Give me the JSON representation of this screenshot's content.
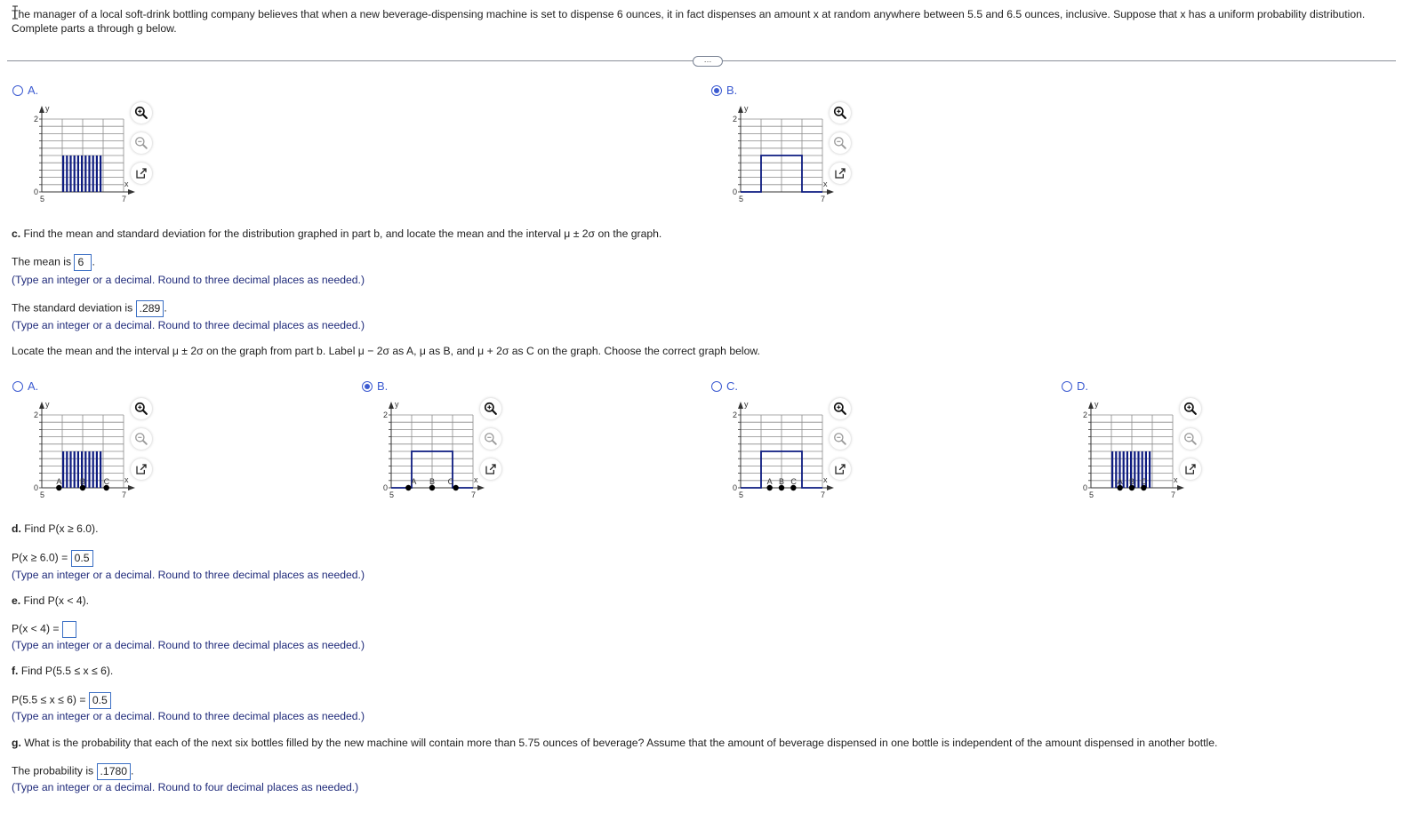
{
  "intro": {
    "text": "The manager of a local soft-drink bottling company believes that when a new beverage-dispensing machine is set to dispense 6 ounces, it in fact dispenses an amount x at random anywhere between 5.5 and 6.5 ounces, inclusive. Suppose that x has a uniform probability distribution. Complete parts a through g below."
  },
  "expand_button": "…",
  "part_b_options": [
    {
      "letter": "A.",
      "selected": false,
      "style": "shaded-rect",
      "show_points": false
    },
    {
      "letter": "B.",
      "selected": true,
      "style": "outline-rect",
      "show_points": false
    }
  ],
  "graph_common": {
    "y_label": "y",
    "x_label": "x",
    "y_top_tick": "2",
    "y_zero_tick": "0",
    "x_min_tick": "5",
    "x_max_tick": "7",
    "xlim": [
      5,
      7
    ],
    "ylim": [
      0,
      2
    ],
    "uniform_low": 5.5,
    "uniform_high": 6.5,
    "density": 1,
    "colors": {
      "curve": "#0d1b80",
      "grid": "#8c8c8c",
      "axis": "#333333"
    }
  },
  "part_c": {
    "prompt_bold": "c.",
    "prompt": " Find the mean and standard deviation for the distribution graphed in part b, and locate the mean and the interval μ ± 2σ on the graph.",
    "mean_label": "The mean is",
    "mean_value": "6",
    "sd_label": "The standard deviation is",
    "sd_value": ".289",
    "hint_three": "(Type an integer or a decimal. Round to three decimal places as needed.)",
    "locate_prompt": "Locate the mean and the interval μ ± 2σ on the graph from part b. Label μ − 2σ as A, μ as B, and μ + 2σ as C on the graph. Choose the correct graph below."
  },
  "part_c_options": [
    {
      "letter": "A.",
      "selected": false,
      "style": "shaded-rect",
      "points": [
        5.42,
        6.0,
        6.58
      ],
      "labels": [
        "A",
        "B",
        "C"
      ]
    },
    {
      "letter": "B.",
      "selected": true,
      "style": "outline-rect",
      "points": [
        5.42,
        6.0,
        6.58
      ],
      "labels": [
        "A",
        "B",
        "C"
      ]
    },
    {
      "letter": "C.",
      "selected": false,
      "style": "outline-rect",
      "points": [
        5.71,
        6.0,
        6.29
      ],
      "labels": [
        "A",
        "B",
        "C"
      ]
    },
    {
      "letter": "D.",
      "selected": false,
      "style": "shaded-rect",
      "points": [
        5.71,
        6.0,
        6.29
      ],
      "labels": [
        "A",
        "B",
        "C"
      ]
    }
  ],
  "part_d": {
    "prompt_bold": "d.",
    "prompt": " Find P(x ≥ 6.0).",
    "answer_label": "P(x ≥ 6.0) =",
    "answer": "0.5",
    "hint": "(Type an integer or a decimal. Round to three decimal places as needed.)"
  },
  "part_e": {
    "prompt_bold": "e.",
    "prompt": " Find P(x < 4).",
    "answer_label": "P(x < 4) =",
    "answer": "",
    "hint": "(Type an integer or a decimal. Round to three decimal places as needed.)"
  },
  "part_f": {
    "prompt_bold": "f.",
    "prompt": " Find P(5.5 ≤ x ≤ 6).",
    "answer_label": "P(5.5 ≤ x ≤ 6) =",
    "answer": "0.5",
    "hint": "(Type an integer or a decimal. Round to three decimal places as needed.)"
  },
  "part_g": {
    "prompt_bold": "g.",
    "prompt": " What is the probability that each of the next six bottles filled by the new machine will contain more than 5.75 ounces of beverage? Assume that the amount of beverage dispensed in one bottle is independent of the amount dispensed in another bottle.",
    "answer_label": "The probability is",
    "answer": ".1780",
    "hint": "(Type an integer or a decimal. Round to four decimal places as needed.)"
  },
  "icons": [
    "zoom-in-icon",
    "zoom-out-icon",
    "popout-icon"
  ]
}
